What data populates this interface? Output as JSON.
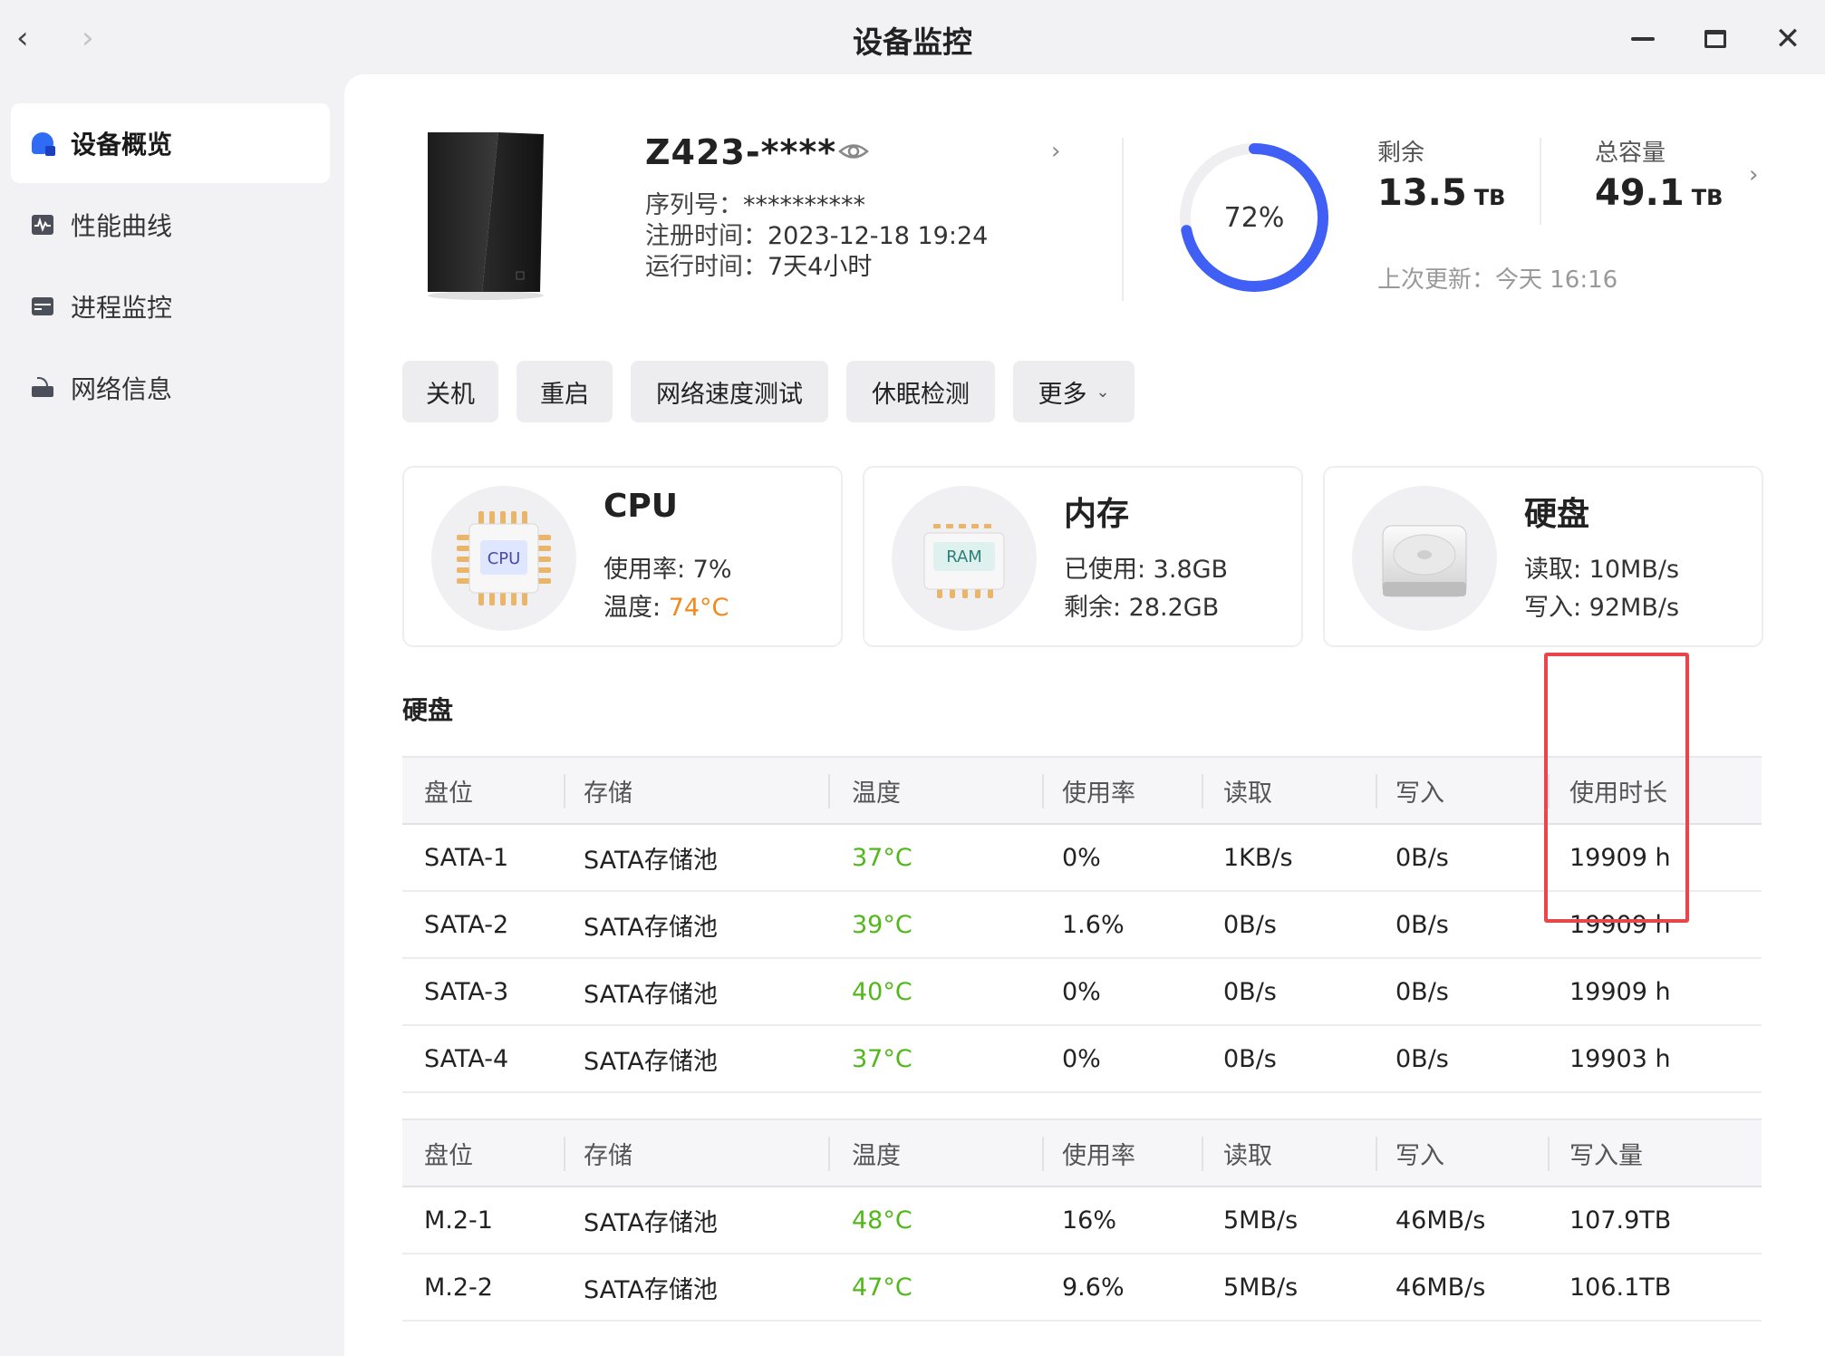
{
  "titlebar": {
    "title": "设备监控",
    "back": "‹",
    "forward": "›",
    "close": "✕"
  },
  "sidebar": {
    "items": [
      {
        "label": "设备概览",
        "icon": "overview-icon",
        "active": true
      },
      {
        "label": "性能曲线",
        "icon": "performance-curve-icon",
        "active": false
      },
      {
        "label": "进程监控",
        "icon": "process-monitor-icon",
        "active": false
      },
      {
        "label": "网络信息",
        "icon": "network-router-icon",
        "active": false
      }
    ]
  },
  "device": {
    "name": "Z423-****",
    "serial_label": "序列号：",
    "serial_value": "**********",
    "reg_label": "注册时间：",
    "reg_value": "2023-12-18 19:24",
    "uptime_label": "运行时间：",
    "uptime_value": "7天4小时"
  },
  "storage": {
    "usage_percent": 72,
    "usage_label": "72%",
    "remaining_label": "剩余",
    "remaining_value": "13.5",
    "remaining_unit": "TB",
    "total_label": "总容量",
    "total_value": "49.1",
    "total_unit": "TB",
    "updated": "上次更新：今天 16:16",
    "ring_color": "#3f5ff5"
  },
  "actions": {
    "shutdown": "关机",
    "restart": "重启",
    "speedtest": "网络速度测试",
    "sleep_check": "休眠检测",
    "more": "更多",
    "more_caret": "⌄"
  },
  "cards": {
    "cpu": {
      "title": "CPU",
      "icon_text": "CPU",
      "usage": "使用率: 7%",
      "temp_label": "温度: ",
      "temp_value": "74°C"
    },
    "memory": {
      "title": "内存",
      "icon_text": "RAM",
      "used": "已使用: 3.8GB",
      "free": "剩余: 28.2GB"
    },
    "disk": {
      "title": "硬盘",
      "read": "读取: 10MB/s",
      "write": "写入: 92MB/s"
    }
  },
  "disk_section_title": "硬盘",
  "sata_table": {
    "headers": [
      "盘位",
      "存储",
      "温度",
      "使用率",
      "读取",
      "写入",
      "使用时长"
    ],
    "rows": [
      [
        "SATA-1",
        "SATA存储池",
        "37°C",
        "0%",
        "1KB/s",
        "0B/s",
        "19909 h"
      ],
      [
        "SATA-2",
        "SATA存储池",
        "39°C",
        "1.6%",
        "0B/s",
        "0B/s",
        "19909 h"
      ],
      [
        "SATA-3",
        "SATA存储池",
        "40°C",
        "0%",
        "0B/s",
        "0B/s",
        "19909 h"
      ],
      [
        "SATA-4",
        "SATA存储池",
        "37°C",
        "0%",
        "0B/s",
        "0B/s",
        "19903 h"
      ]
    ]
  },
  "m2_table": {
    "headers": [
      "盘位",
      "存储",
      "温度",
      "使用率",
      "读取",
      "写入",
      "写入量"
    ],
    "rows": [
      [
        "M.2-1",
        "SATA存储池",
        "48°C",
        "16%",
        "5MB/s",
        "46MB/s",
        "107.9TB"
      ],
      [
        "M.2-2",
        "SATA存储池",
        "47°C",
        "9.6%",
        "5MB/s",
        "46MB/s",
        "106.1TB"
      ]
    ]
  },
  "colors": {
    "accent": "#2f6cf6",
    "temp_ok": "#52b81a",
    "temp_warn": "#f08a1c",
    "highlight": "#e8464c"
  }
}
